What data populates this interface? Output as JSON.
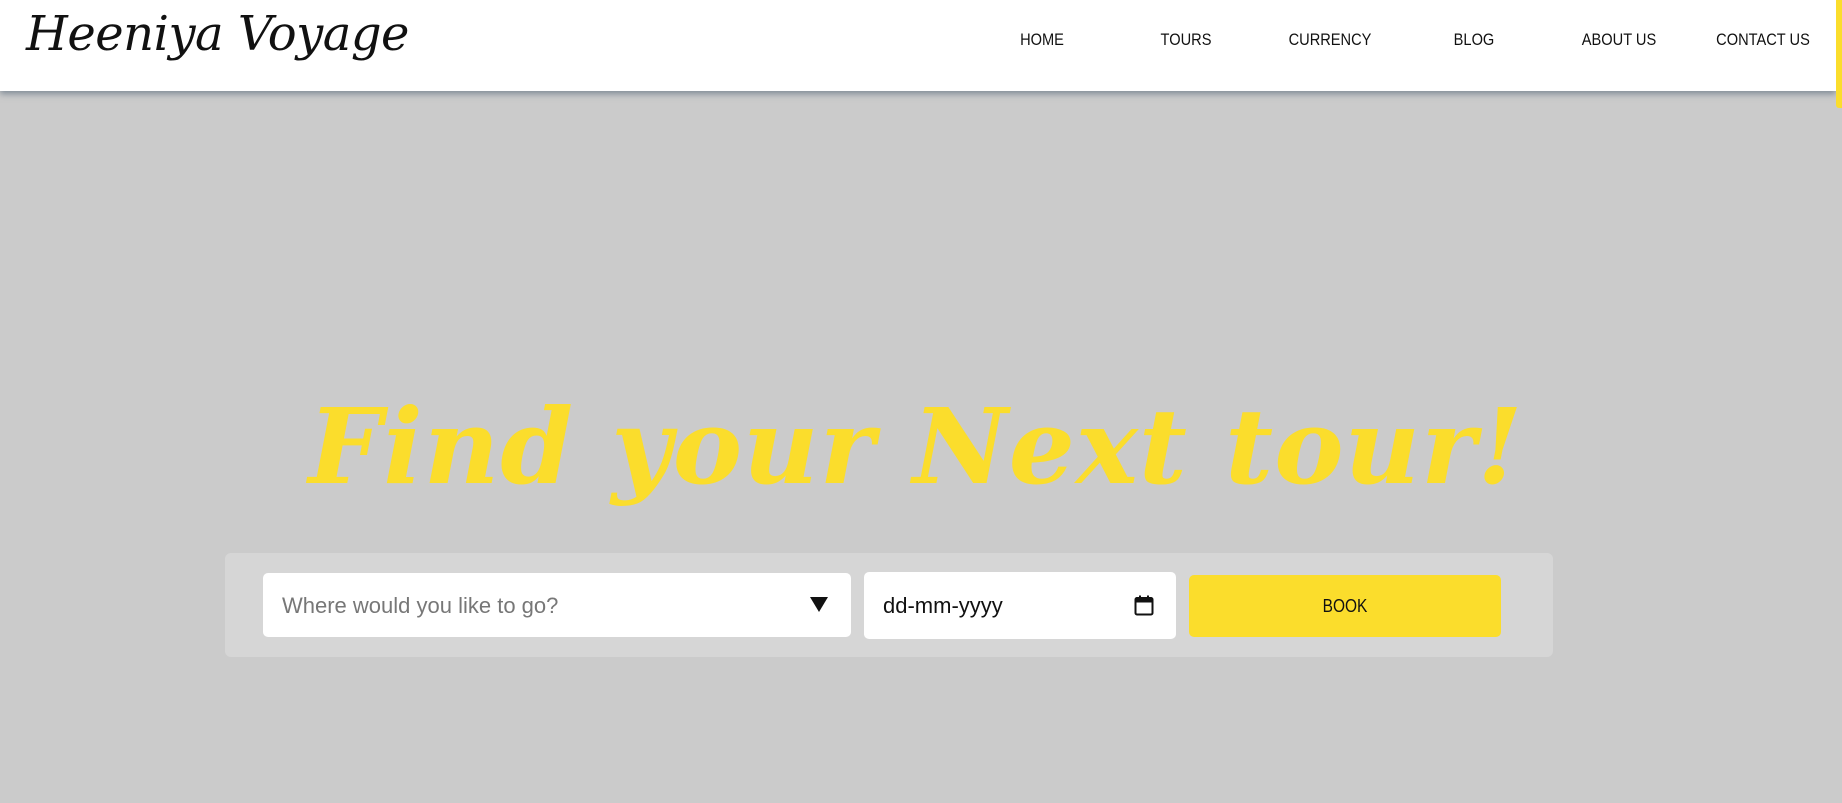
{
  "header": {
    "logo_text": "Heeniya Voyage",
    "nav": [
      {
        "label": "HOME"
      },
      {
        "label": "TOURS"
      },
      {
        "label": "CURRENCY"
      },
      {
        "label": "BLOG"
      },
      {
        "label": "ABOUT US"
      },
      {
        "label": "CONTACT US"
      }
    ]
  },
  "hero": {
    "title": "Find your Next tour!"
  },
  "search": {
    "destination_placeholder": "Where would you like to go?",
    "date_value": "dd-mm-yyyy",
    "book_label": "BOOK"
  },
  "icons": {
    "dropdown": "caret-down-icon",
    "date": "calendar-icon"
  },
  "colors": {
    "accent": "#fbdd2c",
    "background": "#cbcbcb",
    "panel": "#d6d6d6",
    "navbar": "#ffffff",
    "text": "#111111"
  }
}
